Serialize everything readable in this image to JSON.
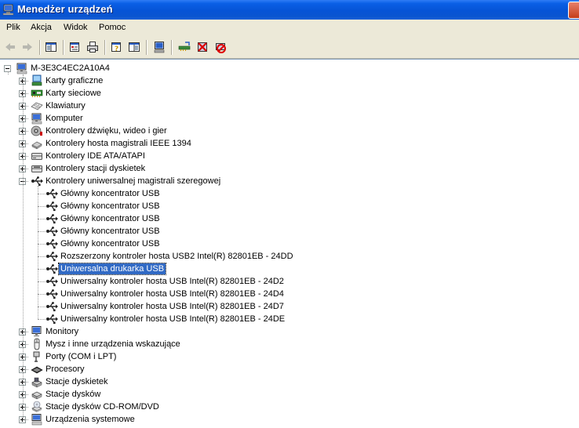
{
  "window": {
    "title": "Menedżer urządzeń"
  },
  "menu": [
    "Plik",
    "Akcja",
    "Widok",
    "Pomoc"
  ],
  "toolbar": {
    "buttons": [
      "back-icon",
      "forward-icon",
      "show-hide-tree-icon",
      "properties-icon",
      "print-icon",
      "help-icon",
      "show-hide-action-pane-icon",
      "scan-hardware-icon",
      "update-driver-icon",
      "disable-device-icon",
      "uninstall-device-icon"
    ]
  },
  "tree": {
    "root": {
      "label": "M-3E3C4EC2A10A4",
      "icon": "computer-icon"
    },
    "categories": [
      {
        "label": "Karty graficzne",
        "icon": "display-adapter-icon",
        "expanded": false
      },
      {
        "label": "Karty sieciowe",
        "icon": "network-adapter-icon",
        "expanded": false
      },
      {
        "label": "Klawiatury",
        "icon": "keyboard-icon",
        "expanded": false
      },
      {
        "label": "Komputer",
        "icon": "computer-icon",
        "expanded": false
      },
      {
        "label": "Kontrolery dźwięku, wideo i gier",
        "icon": "sound-icon",
        "expanded": false
      },
      {
        "label": "Kontrolery hosta magistrali IEEE 1394",
        "icon": "ieee1394-icon",
        "expanded": false
      },
      {
        "label": "Kontrolery IDE ATA/ATAPI",
        "icon": "ide-icon",
        "expanded": false
      },
      {
        "label": "Kontrolery stacji dyskietek",
        "icon": "floppy-controller-icon",
        "expanded": false
      },
      {
        "label": "Kontrolery uniwersalnej magistrali szeregowej",
        "icon": "usb-icon",
        "expanded": true,
        "children": [
          {
            "label": "Główny koncentrator USB",
            "icon": "usb-icon"
          },
          {
            "label": "Główny koncentrator USB",
            "icon": "usb-icon"
          },
          {
            "label": "Główny koncentrator USB",
            "icon": "usb-icon"
          },
          {
            "label": "Główny koncentrator USB",
            "icon": "usb-icon"
          },
          {
            "label": "Główny koncentrator USB",
            "icon": "usb-icon"
          },
          {
            "label": "Rozszerzony kontroler hosta USB2 Intel(R) 82801EB - 24DD",
            "icon": "usb-icon"
          },
          {
            "label": "Uniwersalna drukarka USB",
            "icon": "usb-icon",
            "selected": true
          },
          {
            "label": "Uniwersalny kontroler hosta USB Intel(R) 82801EB - 24D2",
            "icon": "usb-icon"
          },
          {
            "label": "Uniwersalny kontroler hosta USB Intel(R) 82801EB - 24D4",
            "icon": "usb-icon"
          },
          {
            "label": "Uniwersalny kontroler hosta USB Intel(R) 82801EB - 24D7",
            "icon": "usb-icon"
          },
          {
            "label": "Uniwersalny kontroler hosta USB Intel(R) 82801EB - 24DE",
            "icon": "usb-icon"
          }
        ]
      },
      {
        "label": "Monitory",
        "icon": "monitor-icon",
        "expanded": false
      },
      {
        "label": "Mysz i inne urządzenia wskazujące",
        "icon": "mouse-icon",
        "expanded": false
      },
      {
        "label": "Porty (COM i LPT)",
        "icon": "port-icon",
        "expanded": false
      },
      {
        "label": "Procesory",
        "icon": "processor-icon",
        "expanded": false
      },
      {
        "label": "Stacje dyskietek",
        "icon": "floppy-drive-icon",
        "expanded": false
      },
      {
        "label": "Stacje dysków",
        "icon": "disk-drive-icon",
        "expanded": false
      },
      {
        "label": "Stacje dysków CD-ROM/DVD",
        "icon": "cdrom-icon",
        "expanded": false
      },
      {
        "label": "Urządzenia systemowe",
        "icon": "system-device-icon",
        "expanded": false
      }
    ]
  }
}
